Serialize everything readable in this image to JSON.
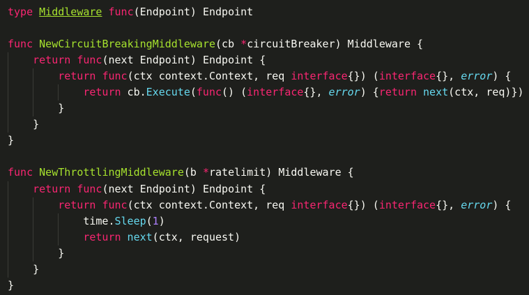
{
  "editor": {
    "theme_colors": {
      "background": "#1e1f1c",
      "text": "#f8f8f2",
      "keyword": "#f92672",
      "function": "#a6e22e",
      "type": "#66d9ef",
      "number": "#ae81ff"
    },
    "lines": [
      {
        "indent": 0,
        "tokens": [
          [
            "kw",
            "type"
          ],
          [
            "",
            ""
          ],
          [
            "",
            " "
          ],
          [
            "fnu",
            "Middleware"
          ],
          [
            "",
            " "
          ],
          [
            "kw",
            "func"
          ],
          [
            "",
            "(Endpoint) Endpoint"
          ]
        ]
      },
      {
        "indent": 0,
        "tokens": []
      },
      {
        "indent": 0,
        "tokens": [
          [
            "kw",
            "func"
          ],
          [
            "",
            " "
          ],
          [
            "fn",
            "NewCircuitBreakingMiddleware"
          ],
          [
            "",
            "(cb "
          ],
          [
            "kw",
            "*"
          ],
          [
            "",
            "circuitBreaker) Middleware {"
          ]
        ]
      },
      {
        "indent": 1,
        "tokens": [
          [
            "kw",
            "return"
          ],
          [
            "",
            " "
          ],
          [
            "kw",
            "func"
          ],
          [
            "",
            "(next Endpoint) Endpoint {"
          ]
        ]
      },
      {
        "indent": 2,
        "tokens": [
          [
            "kw",
            "return"
          ],
          [
            "",
            " "
          ],
          [
            "kw",
            "func"
          ],
          [
            "",
            "(ctx context.Context, req "
          ],
          [
            "kw",
            "interface"
          ],
          [
            "",
            "{}) ("
          ],
          [
            "kw",
            "interface"
          ],
          [
            "",
            "{}, "
          ],
          [
            "tyi",
            "error"
          ],
          [
            "",
            ") {"
          ]
        ]
      },
      {
        "indent": 3,
        "tokens": [
          [
            "kw",
            "return"
          ],
          [
            "",
            " cb."
          ],
          [
            "ty",
            "Execute"
          ],
          [
            "",
            "("
          ],
          [
            "kw",
            "func"
          ],
          [
            "",
            "() ("
          ],
          [
            "kw",
            "interface"
          ],
          [
            "",
            "{}, "
          ],
          [
            "tyi",
            "error"
          ],
          [
            "",
            ") {"
          ],
          [
            "kw",
            "return"
          ],
          [
            "",
            " "
          ],
          [
            "ty",
            "next"
          ],
          [
            "",
            "(ctx, req)})"
          ]
        ]
      },
      {
        "indent": 2,
        "tokens": [
          [
            "",
            "}"
          ]
        ]
      },
      {
        "indent": 1,
        "tokens": [
          [
            "",
            "}"
          ]
        ]
      },
      {
        "indent": 0,
        "tokens": [
          [
            "",
            "}"
          ]
        ]
      },
      {
        "indent": 0,
        "tokens": []
      },
      {
        "indent": 0,
        "tokens": [
          [
            "kw",
            "func"
          ],
          [
            "",
            " "
          ],
          [
            "fn",
            "NewThrottlingMiddleware"
          ],
          [
            "",
            "(b "
          ],
          [
            "kw",
            "*"
          ],
          [
            "",
            "ratelimit) Middleware {"
          ]
        ]
      },
      {
        "indent": 1,
        "tokens": [
          [
            "kw",
            "return"
          ],
          [
            "",
            " "
          ],
          [
            "kw",
            "func"
          ],
          [
            "",
            "(next Endpoint) Endpoint {"
          ]
        ]
      },
      {
        "indent": 2,
        "tokens": [
          [
            "kw",
            "return"
          ],
          [
            "",
            " "
          ],
          [
            "kw",
            "func"
          ],
          [
            "",
            "(ctx context.Context, req "
          ],
          [
            "kw",
            "interface"
          ],
          [
            "",
            "{}) ("
          ],
          [
            "kw",
            "interface"
          ],
          [
            "",
            "{}, "
          ],
          [
            "tyi",
            "error"
          ],
          [
            "",
            ") {"
          ]
        ]
      },
      {
        "indent": 3,
        "tokens": [
          [
            "",
            "time."
          ],
          [
            "ty",
            "Sleep"
          ],
          [
            "",
            "("
          ],
          [
            "num",
            "1"
          ],
          [
            "",
            ")"
          ]
        ]
      },
      {
        "indent": 3,
        "tokens": [
          [
            "kw",
            "return"
          ],
          [
            "",
            " "
          ],
          [
            "ty",
            "next"
          ],
          [
            "",
            "(ctx, request)"
          ]
        ]
      },
      {
        "indent": 2,
        "tokens": [
          [
            "",
            "}"
          ]
        ]
      },
      {
        "indent": 1,
        "tokens": [
          [
            "",
            "}"
          ]
        ]
      },
      {
        "indent": 0,
        "tokens": [
          [
            "",
            "}"
          ]
        ]
      }
    ]
  }
}
